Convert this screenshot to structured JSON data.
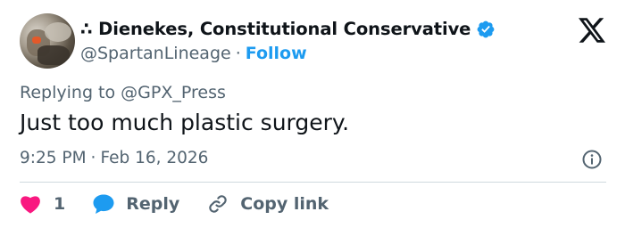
{
  "author": {
    "display_name": "∴ Dienekes, Constitutional Conservative",
    "handle": "@SpartanLineage",
    "separator": "·",
    "follow_label": "Follow",
    "verified": true
  },
  "platform": {
    "logo": "x-logo-icon"
  },
  "reply_context": {
    "prefix": "Replying to",
    "mention": "@GPX_Press"
  },
  "tweet": {
    "text": "Just too much plastic surgery.",
    "time": "9:25 PM",
    "separator": "·",
    "date": "Feb 16, 2026"
  },
  "actions": {
    "like_count": "1",
    "reply_label": "Reply",
    "copy_link_label": "Copy link"
  },
  "colors": {
    "accent": "#1d9bf0",
    "like": "#f91880",
    "secondary_text": "#536471",
    "primary_text": "#0f1419",
    "divider": "#cfd9de"
  },
  "icons": [
    "verified-badge-icon",
    "x-logo-icon",
    "info-icon",
    "heart-icon",
    "reply-bubble-icon",
    "link-icon"
  ]
}
